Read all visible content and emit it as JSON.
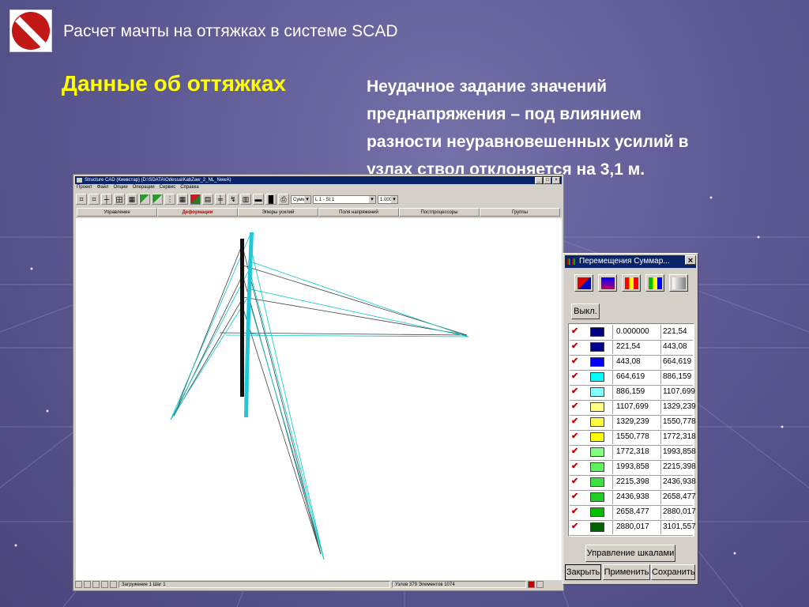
{
  "slide": {
    "title": "Расчет мачты на оттяжках в системе  SCAD",
    "heading": "Данные об оттяжках",
    "body_lines": [
      "Неудачное задание значений",
      "преднапряжения – под влиянием",
      "разности неуравновешенных усилий в",
      "узлах ствол отклоняется на 3,1 м."
    ]
  },
  "scad": {
    "window_title": "Structure CAD (Киевстар) (D:\\SDATA\\Odessa\\KabZaw_2_NL_NewA)",
    "window_buttons": [
      "_",
      "□",
      "×"
    ],
    "menu": [
      "Проект",
      "Файл",
      "Опции",
      "Операции",
      "Сервис",
      "Справка"
    ],
    "toolbar_select_1": "Сумм",
    "toolbar_select_2": "L 1 - St 1",
    "toolbar_select_3": "1.000",
    "tabs": [
      {
        "label": "Управление",
        "active": false
      },
      {
        "label": "Деформации",
        "active": true
      },
      {
        "label": "Эпюры усилий",
        "active": false
      },
      {
        "label": "Поля напряжений",
        "active": false
      },
      {
        "label": "Постпроцессоры",
        "active": false
      },
      {
        "label": "Группы",
        "active": false
      }
    ],
    "status_load": "Загружение 1  Шаг 1",
    "status_info": "Узлов 379 Элементов 1074"
  },
  "legend_panel": {
    "title": "Перемещения Суммар...",
    "close": "×",
    "off_button": "Выкл.",
    "scale_button": "Управление шкалами",
    "close_button": "Закрыть",
    "apply_button": "Применить",
    "save_button": "Сохранить",
    "rows": [
      {
        "from": "0.000000",
        "to": "221,54",
        "color": "#000080"
      },
      {
        "from": "221,54",
        "to": "443,08",
        "color": "#00008c"
      },
      {
        "from": "443,08",
        "to": "664,619",
        "color": "#0000ff"
      },
      {
        "from": "664,619",
        "to": "886,159",
        "color": "#00ffff"
      },
      {
        "from": "886,159",
        "to": "1107,699",
        "color": "#80ffff"
      },
      {
        "from": "1107,699",
        "to": "1329,239",
        "color": "#ffff80"
      },
      {
        "from": "1329,239",
        "to": "1550,778",
        "color": "#ffff40"
      },
      {
        "from": "1550,778",
        "to": "1772,318",
        "color": "#ffff00"
      },
      {
        "from": "1772,318",
        "to": "1993,858",
        "color": "#80ff80"
      },
      {
        "from": "1993,858",
        "to": "2215,398",
        "color": "#60f060"
      },
      {
        "from": "2215,398",
        "to": "2436,938",
        "color": "#40e040"
      },
      {
        "from": "2436,938",
        "to": "2658,477",
        "color": "#20d020"
      },
      {
        "from": "2658,477",
        "to": "2880,017",
        "color": "#00c000"
      },
      {
        "from": "2880,017",
        "to": "3101,557",
        "color": "#006400"
      }
    ]
  }
}
